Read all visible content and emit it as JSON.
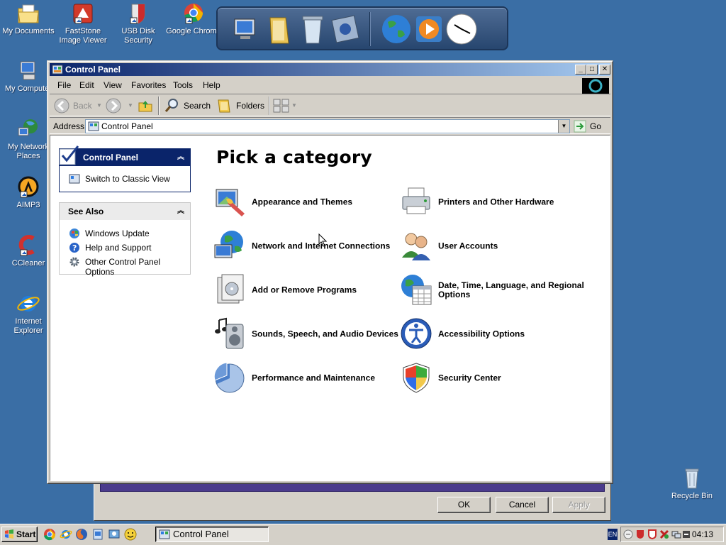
{
  "desktop": {
    "icons": [
      {
        "label": "My Documents"
      },
      {
        "label": "FastStone Image Viewer"
      },
      {
        "label": "USB Disk Security"
      },
      {
        "label": "Google Chrome"
      },
      {
        "label": "My Computer"
      },
      {
        "label": "My Network Places"
      },
      {
        "label": "AIMP3"
      },
      {
        "label": "CCleaner"
      },
      {
        "label": "Internet Explorer"
      },
      {
        "label": "Recycle Bin"
      }
    ]
  },
  "window": {
    "title": "Control Panel",
    "menu": [
      "File",
      "Edit",
      "View",
      "Favorites",
      "Tools",
      "Help"
    ],
    "toolbar": {
      "back": "Back",
      "search": "Search",
      "folders": "Folders"
    },
    "address": {
      "label": "Address",
      "value": "Control Panel",
      "go": "Go"
    }
  },
  "left_pane": {
    "control_panel_header": "Control Panel",
    "switch_view": "Switch to Classic View",
    "see_also_header": "See Also",
    "see_also_links": [
      "Windows Update",
      "Help and Support",
      "Other Control Panel Options"
    ]
  },
  "main": {
    "heading": "Pick a category",
    "categories": [
      {
        "label": "Appearance and Themes"
      },
      {
        "label": "Printers and Other Hardware"
      },
      {
        "label": "Network and Internet Connections"
      },
      {
        "label": "User Accounts"
      },
      {
        "label": "Add or Remove Programs"
      },
      {
        "label": "Date, Time, Language, and Regional Options"
      },
      {
        "label": "Sounds, Speech, and Audio Devices"
      },
      {
        "label": "Accessibility Options"
      },
      {
        "label": "Performance and Maintenance"
      },
      {
        "label": "Security Center"
      }
    ]
  },
  "background_dialog": {
    "ok": "OK",
    "cancel": "Cancel",
    "apply": "Apply"
  },
  "taskbar": {
    "start": "Start",
    "task": "Control Panel",
    "language": "EN",
    "clock": "04:13"
  },
  "colors": {
    "desktop": "#3a6ea5",
    "title_active": "#0a246a",
    "face": "#d4d0c8"
  }
}
